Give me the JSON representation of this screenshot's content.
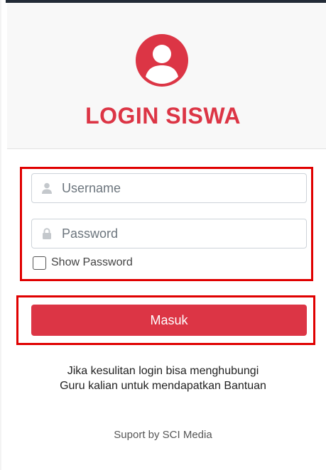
{
  "header": {
    "title": "LOGIN SISWA"
  },
  "form": {
    "username_placeholder": "Username",
    "password_placeholder": "Password",
    "show_password_label": "Show Password",
    "submit_label": "Masuk"
  },
  "help": {
    "line1": "Jika kesulitan login bisa menghubungi",
    "line2": "Guru kalian untuk mendapatkan Bantuan"
  },
  "footer": {
    "text": "Suport by SCI Media"
  },
  "icons": {
    "avatar": "user-circle-icon",
    "username": "user-icon",
    "password": "lock-icon"
  },
  "colors": {
    "accent": "#dc3545",
    "highlight_border": "#e00000",
    "header_bg": "#f8f8f8",
    "input_icon": "#c4c8cc"
  }
}
